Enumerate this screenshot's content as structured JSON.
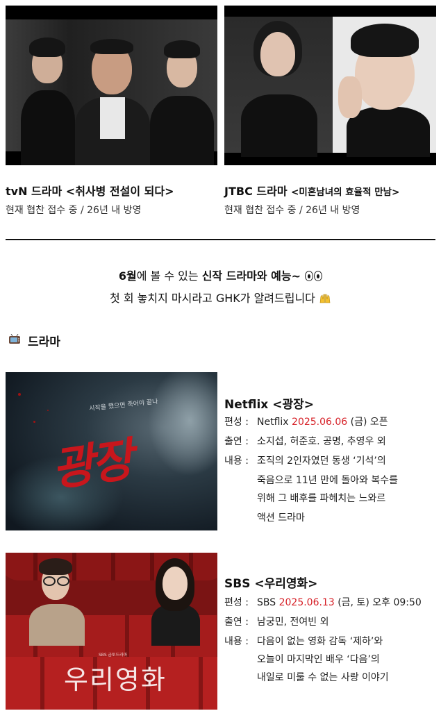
{
  "top_shows": [
    {
      "network": "tvN 드라마",
      "title": "<취사병 전설이 되다>",
      "status": "현재 협찬 접수 중 / 26년 내 방영"
    },
    {
      "network": "JTBC 드라마",
      "title": "<미혼남녀의 효율적 만남>",
      "status": "현재 협찬 접수 중 / 26년 내 방영"
    }
  ],
  "intro": {
    "line1_bold_a": "6월",
    "line1_mid": "에 볼 수 있는 ",
    "line1_bold_b": "신작 드라마와 예능~",
    "line2": "첫 회 놓치지 마시라고 GHK가 알려드립니다",
    "eyes_icon": "eyes-emoji",
    "hands_icon": "raised-hands-emoji"
  },
  "section": {
    "icon": "tv-icon",
    "label": "드라마"
  },
  "dramas": [
    {
      "poster_title": "광장",
      "poster_tagline": "시작을 했으면 죽어야 끝나",
      "title": "Netflix <광장>",
      "schedule_label": "편성 :",
      "schedule_pre": "Netflix ",
      "schedule_date": "2025.06.06",
      "schedule_post": " (금) 오픈",
      "cast_label": "출연 :",
      "cast": "소지섭, 허준호. 공명, 추영우 외",
      "content_label": "내용 :",
      "content_lines": [
        "조직의 2인자였던 동생 ‘기석’의",
        "죽음으로 11년 만에 돌아와 복수를",
        "위해 그 배후를 파헤치는 느와르",
        "액션 드라마"
      ]
    },
    {
      "poster_title": "우리영화",
      "poster_tagline": "SBS 금토드라마",
      "title": "SBS <우리영화>",
      "schedule_label": "편성 :",
      "schedule_pre": "SBS ",
      "schedule_date": "2025.06.13",
      "schedule_post": " (금, 토) 오후 09:50",
      "cast_label": "출연 :",
      "cast": "남궁민, 전여빈 외",
      "content_label": "내용 :",
      "content_lines": [
        "다음이 없는 영화 감독 ‘제하’와",
        "오늘이 마지막인 배우 ‘다음’의",
        "내일로 미룰 수 없는 사랑 이야기"
      ]
    }
  ],
  "colors": {
    "date_red": "#d61f26",
    "text": "#111111"
  }
}
